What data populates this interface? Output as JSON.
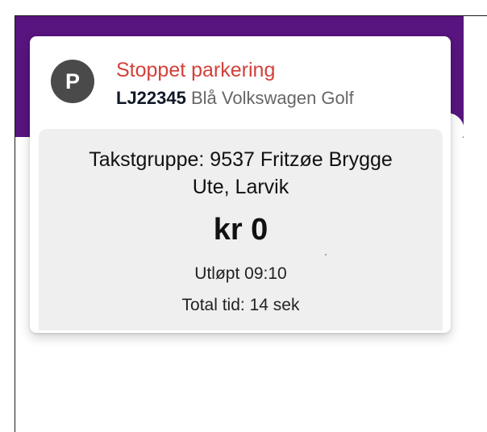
{
  "colors": {
    "brand_purple": "#58147f",
    "status_red": "#d2413a",
    "icon_gray": "#4a4a4a",
    "panel_gray": "#efefef"
  },
  "parking_card": {
    "icon_name": "parking-icon",
    "icon_letter": "P",
    "status_title": "Stoppet parkering",
    "plate": "LJ22345",
    "vehicle_desc": "Blå Volkswagen Golf",
    "zone_line_1": "Takstgruppe: 9537 Fritzøe Brygge",
    "zone_line_2": "Ute, Larvik",
    "price": "kr 0",
    "expired": "Utløpt 09:10",
    "total_time": "Total tid: 14 sek"
  }
}
